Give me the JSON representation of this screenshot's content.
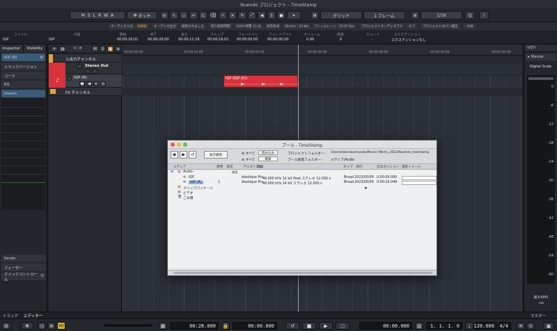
{
  "window_title": "Nuendo プロジェクト - TimeStamp",
  "toolbar": {
    "mode_buttons": [
      "M",
      "S",
      "L",
      "R",
      "W",
      "A"
    ],
    "automation_mode": "タッチ",
    "snap_type": "グリッド",
    "grid_type": "1 フレーム",
    "quantize": "1/16"
  },
  "info_row": {
    "items": [
      "オーディオ入力",
      "未接続",
      "オーディオ出力",
      "接続されました",
      "残り録音時間",
      "1204 時間 13 分",
      "録音形式",
      "48 kHz - 24 bit",
      "フレームレート",
      "25.97 fps",
      "プロジェクトオーディオブル",
      "オフ",
      "プロジェクトのパン補正",
      "-3dB"
    ]
  },
  "field_row": {
    "labels": [
      "ファイル",
      "内容",
      "開始",
      "終了",
      "長さ",
      "スナップ",
      "フェードイン",
      "フェードアウト",
      "ボリューム",
      "移調",
      "ミュート",
      "エクステンション"
    ],
    "values": [
      "IGP",
      "IGP",
      "00:00:16:01",
      "00:00:28:00",
      "00:00:11:29",
      "00:00:16:01",
      "00:00:00:00",
      "00:00:00:00",
      "0.00",
      "0",
      "-",
      "エクステンションなし"
    ]
  },
  "inspector": {
    "tabs": [
      "Inspector",
      "Visibility"
    ],
    "track_name": "IGP (R)",
    "sections": [
      "トラックバージョン",
      "コード",
      "EQ",
      "Inserts"
    ],
    "bottom_sections": [
      "Sends",
      "フェーダー",
      "クイックコントロール"
    ]
  },
  "tracks": {
    "counter": "0 / 8",
    "items": [
      {
        "name": "入出力チャンネル"
      },
      {
        "name": "Stereo Out"
      },
      {
        "name": "IGP (R)"
      },
      {
        "name": "FX チャンネル"
      }
    ]
  },
  "ruler": {
    "ticks": [
      "00:00:00:00",
      "00:00:10:00",
      "00:00:20:00",
      "00:00:30:00",
      "00:00:40:00",
      "00:00:50:00",
      "00:01:00:00",
      "00:01:10:00"
    ]
  },
  "event": {
    "label": "IGP (IGP (R))"
  },
  "mixer": {
    "tabs": [
      "VSTi"
    ],
    "master_label": "Master",
    "scale_label": "Digital Scale",
    "scale_values": [
      "0",
      "-6",
      "-12",
      "-18",
      "-24",
      "-30",
      "-36",
      "-42",
      "-48",
      "-54",
      "-60"
    ],
    "rms_label": "最大RMS",
    "rms_value": "-oo"
  },
  "bottom_tabs": {
    "left": [
      "トラック",
      "エディター"
    ],
    "right": "マスター"
  },
  "transport": {
    "primary_time": "00:28.000",
    "secondary_time": "00:00.000",
    "position_time": "00:00.000",
    "bars": "1. 1. 1. 0",
    "tempo": "120.000",
    "signature": "4/4",
    "aq": "AQ"
  },
  "pool": {
    "title": "プール - TimeStamp",
    "view_label": "表示属性",
    "all_label_1": "すべて",
    "all_label_2": "すべて",
    "import_button": "読み込み",
    "search_button": "検索",
    "project_folder_label": "プロジェクトフォルダー:",
    "project_folder_value": "/Users/tatarakamasato/Music/ Works_2023/Nuendo_test/stamp",
    "record_folder_label": "プール録音フォルダー:",
    "record_folder_value": "メディア/Audio",
    "columns": [
      "メディア",
      "使用",
      "状況",
      "アルゴリズム",
      "情報",
      "タイプ",
      "日付",
      "元のポジション",
      "波形イメージ"
    ],
    "rows": [
      {
        "name": "Audio",
        "used": "",
        "status": "録音",
        "algorithm": "",
        "info": "",
        "type": "",
        "date": "",
        "origin": ""
      },
      {
        "name": "IGP",
        "used": "",
        "status": "",
        "algorithm": "élastique Pro",
        "info": "48.000 kHz  32 bit float  ステレオ  12.000 s",
        "type": "Broad",
        "date": "2023/05/09",
        "origin": "0:00:00.000"
      },
      {
        "name": "IGP (R)",
        "used": "1",
        "status": "",
        "algorithm": "élastique Pro",
        "info": "48.000 kHz  24 bit  ステレオ  12.000 s",
        "type": "Broad",
        "date": "2023/05/09",
        "origin": "0:00:16.049"
      },
      {
        "name": "クリップパッケージ",
        "used": "",
        "status": "",
        "algorithm": "",
        "info": "",
        "type": "",
        "date": "",
        "origin": ""
      },
      {
        "name": "ビデオ",
        "used": "",
        "status": "",
        "algorithm": "",
        "info": "",
        "type": "",
        "date": "",
        "origin": ""
      },
      {
        "name": "ごみ箱",
        "used": "",
        "status": "",
        "algorithm": "",
        "info": "",
        "type": "",
        "date": "",
        "origin": ""
      }
    ]
  },
  "colors": {
    "event_red": "#d8323c",
    "track_accent": "#d8323c",
    "folder_orange": "#e8a040"
  }
}
